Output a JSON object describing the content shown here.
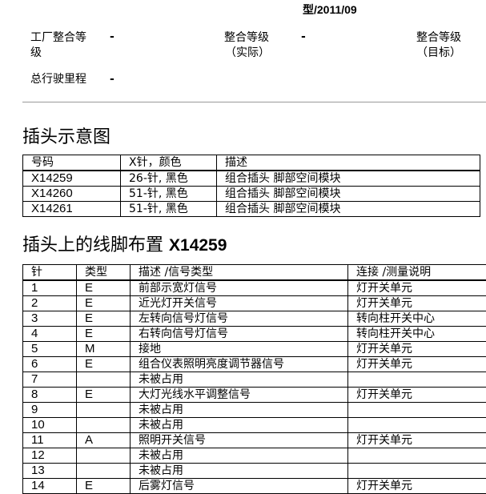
{
  "header": {
    "title_fragment": "型/2011/09",
    "factory_level_label_line1": "工厂整合等",
    "factory_level_label_line2": "级",
    "factory_level_value": "-",
    "actual_level_label_line1": "整合等级",
    "actual_level_label_line2": "（实际）",
    "actual_level_value": "-",
    "target_level_label_line1": "整合等级",
    "target_level_label_line2": "（目标）",
    "mileage_label": "总行驶里程",
    "mileage_value": "-"
  },
  "connector_section": {
    "title": "插头示意图",
    "columns": [
      "号码",
      "X针，颜色",
      "描述"
    ],
    "rows": [
      [
        "X14259",
        "26-针, 黑色",
        "组合插头 脚部空间模块"
      ],
      [
        "X14260",
        "51-针, 黑色",
        "组合插头 脚部空间模块"
      ],
      [
        "X14261",
        "51-针, 黑色",
        "组合插头 脚部空间模块"
      ]
    ]
  },
  "pin_section": {
    "title": "插头上的线脚布置",
    "title_code": "X14259",
    "columns": [
      "针",
      "类型",
      "描述 /信号类型",
      "连接 /测量说明"
    ],
    "rows": [
      [
        "1",
        "E",
        "前部示宽灯信号",
        "灯开关单元"
      ],
      [
        "2",
        "E",
        "近光灯开关信号",
        "灯开关单元"
      ],
      [
        "3",
        "E",
        "左转向信号灯信号",
        "转向柱开关中心"
      ],
      [
        "4",
        "E",
        "右转向信号灯信号",
        "转向柱开关中心"
      ],
      [
        "5",
        "M",
        "接地",
        "灯开关单元"
      ],
      [
        "6",
        "E",
        "组合仪表照明亮度调节器信号",
        "灯开关单元"
      ],
      [
        "7",
        "",
        "未被占用",
        ""
      ],
      [
        "8",
        "E",
        "大灯光线水平调整信号",
        "灯开关单元"
      ],
      [
        "9",
        "",
        "未被占用",
        ""
      ],
      [
        "10",
        "",
        "未被占用",
        ""
      ],
      [
        "11",
        "A",
        "照明开关信号",
        "灯开关单元"
      ],
      [
        "12",
        "",
        "未被占用",
        ""
      ],
      [
        "13",
        "",
        "未被占用",
        ""
      ],
      [
        "14",
        "E",
        "后雾灯信号",
        "灯开关单元"
      ]
    ]
  }
}
